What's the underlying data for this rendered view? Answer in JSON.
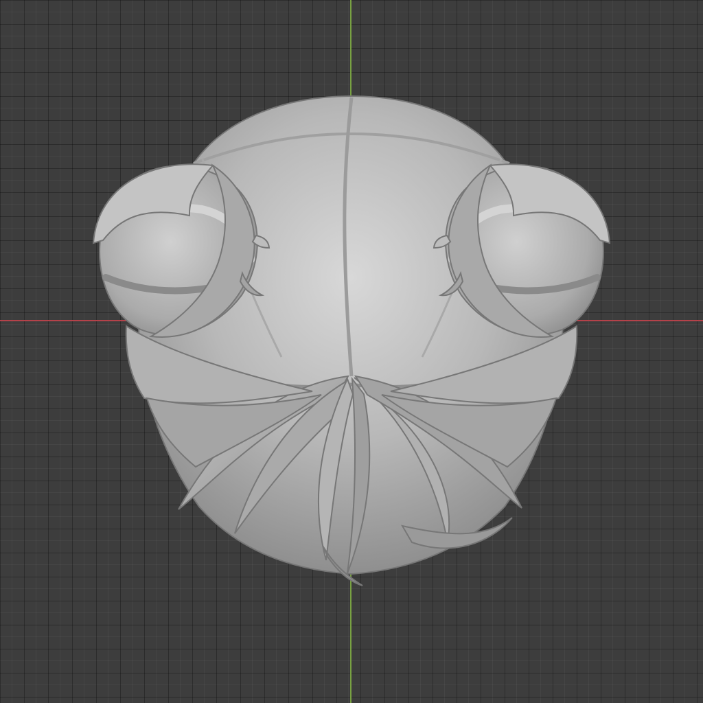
{
  "viewport": {
    "background_color": "#3d3d3d",
    "grid_color": "#353535",
    "x_axis_color": "#b5424a",
    "y_axis_color": "#78a142",
    "model_base_color": "#b9b9b9",
    "model_shadow_color": "#8e8e8e",
    "model_highlight_color": "#d6d6d6"
  }
}
